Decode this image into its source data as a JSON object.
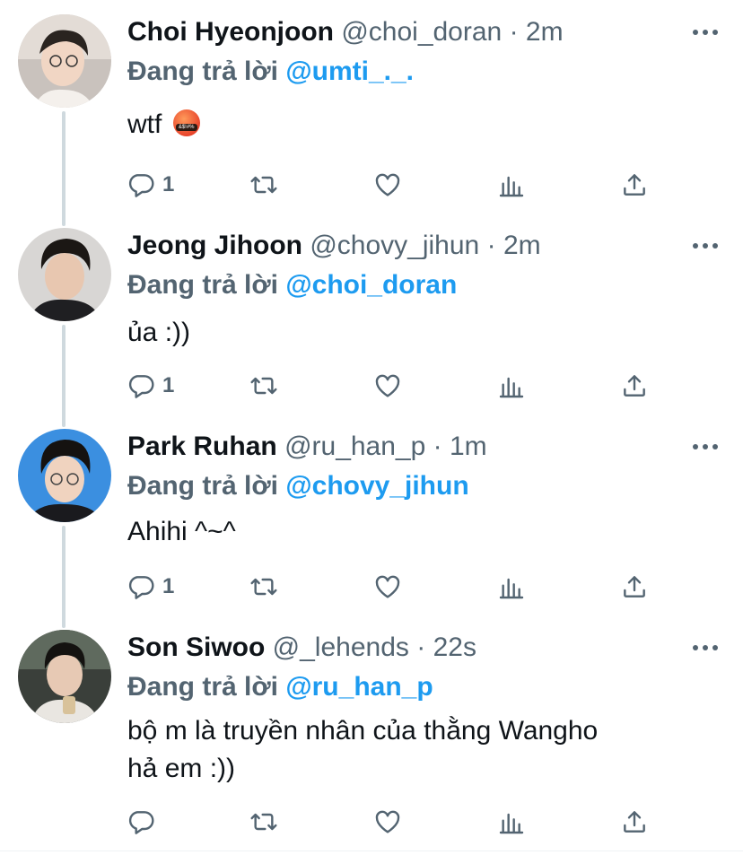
{
  "reply_prefix": "Đang trả lời",
  "colors": {
    "accent": "#1d9bf0",
    "muted": "#536471",
    "text": "#0f1419",
    "thread_line": "#cfd9de"
  },
  "tweets": [
    {
      "name": "Choi Hyeonjoon",
      "handle": "@choi_doran",
      "sep": "·",
      "time": "2m",
      "reply_to": "@umti_._.",
      "text": "wtf",
      "emoji": "face-with-symbols-on-mouth",
      "emoji_text": "&$!#%",
      "reply_count": "1"
    },
    {
      "name": "Jeong Jihoon",
      "handle": "@chovy_jihun",
      "sep": "·",
      "time": "2m",
      "reply_to": "@choi_doran",
      "text": "ủa :))",
      "reply_count": "1"
    },
    {
      "name": "Park Ruhan",
      "handle": "@ru_han_p",
      "sep": "·",
      "time": "1m",
      "reply_to": "@chovy_jihun",
      "text": "Ahihi ^~^",
      "reply_count": "1"
    },
    {
      "name": "Son Siwoo",
      "handle": "@_lehends",
      "sep": "·",
      "time": "22s",
      "reply_to": "@ru_han_p",
      "text_line1": "bộ m là truyền nhân của thằng Wangho",
      "text_line2": "hả em :))",
      "reply_count": ""
    }
  ],
  "icons": [
    "more-icon",
    "reply-icon",
    "retweet-icon",
    "like-icon",
    "analytics-icon",
    "share-icon"
  ]
}
